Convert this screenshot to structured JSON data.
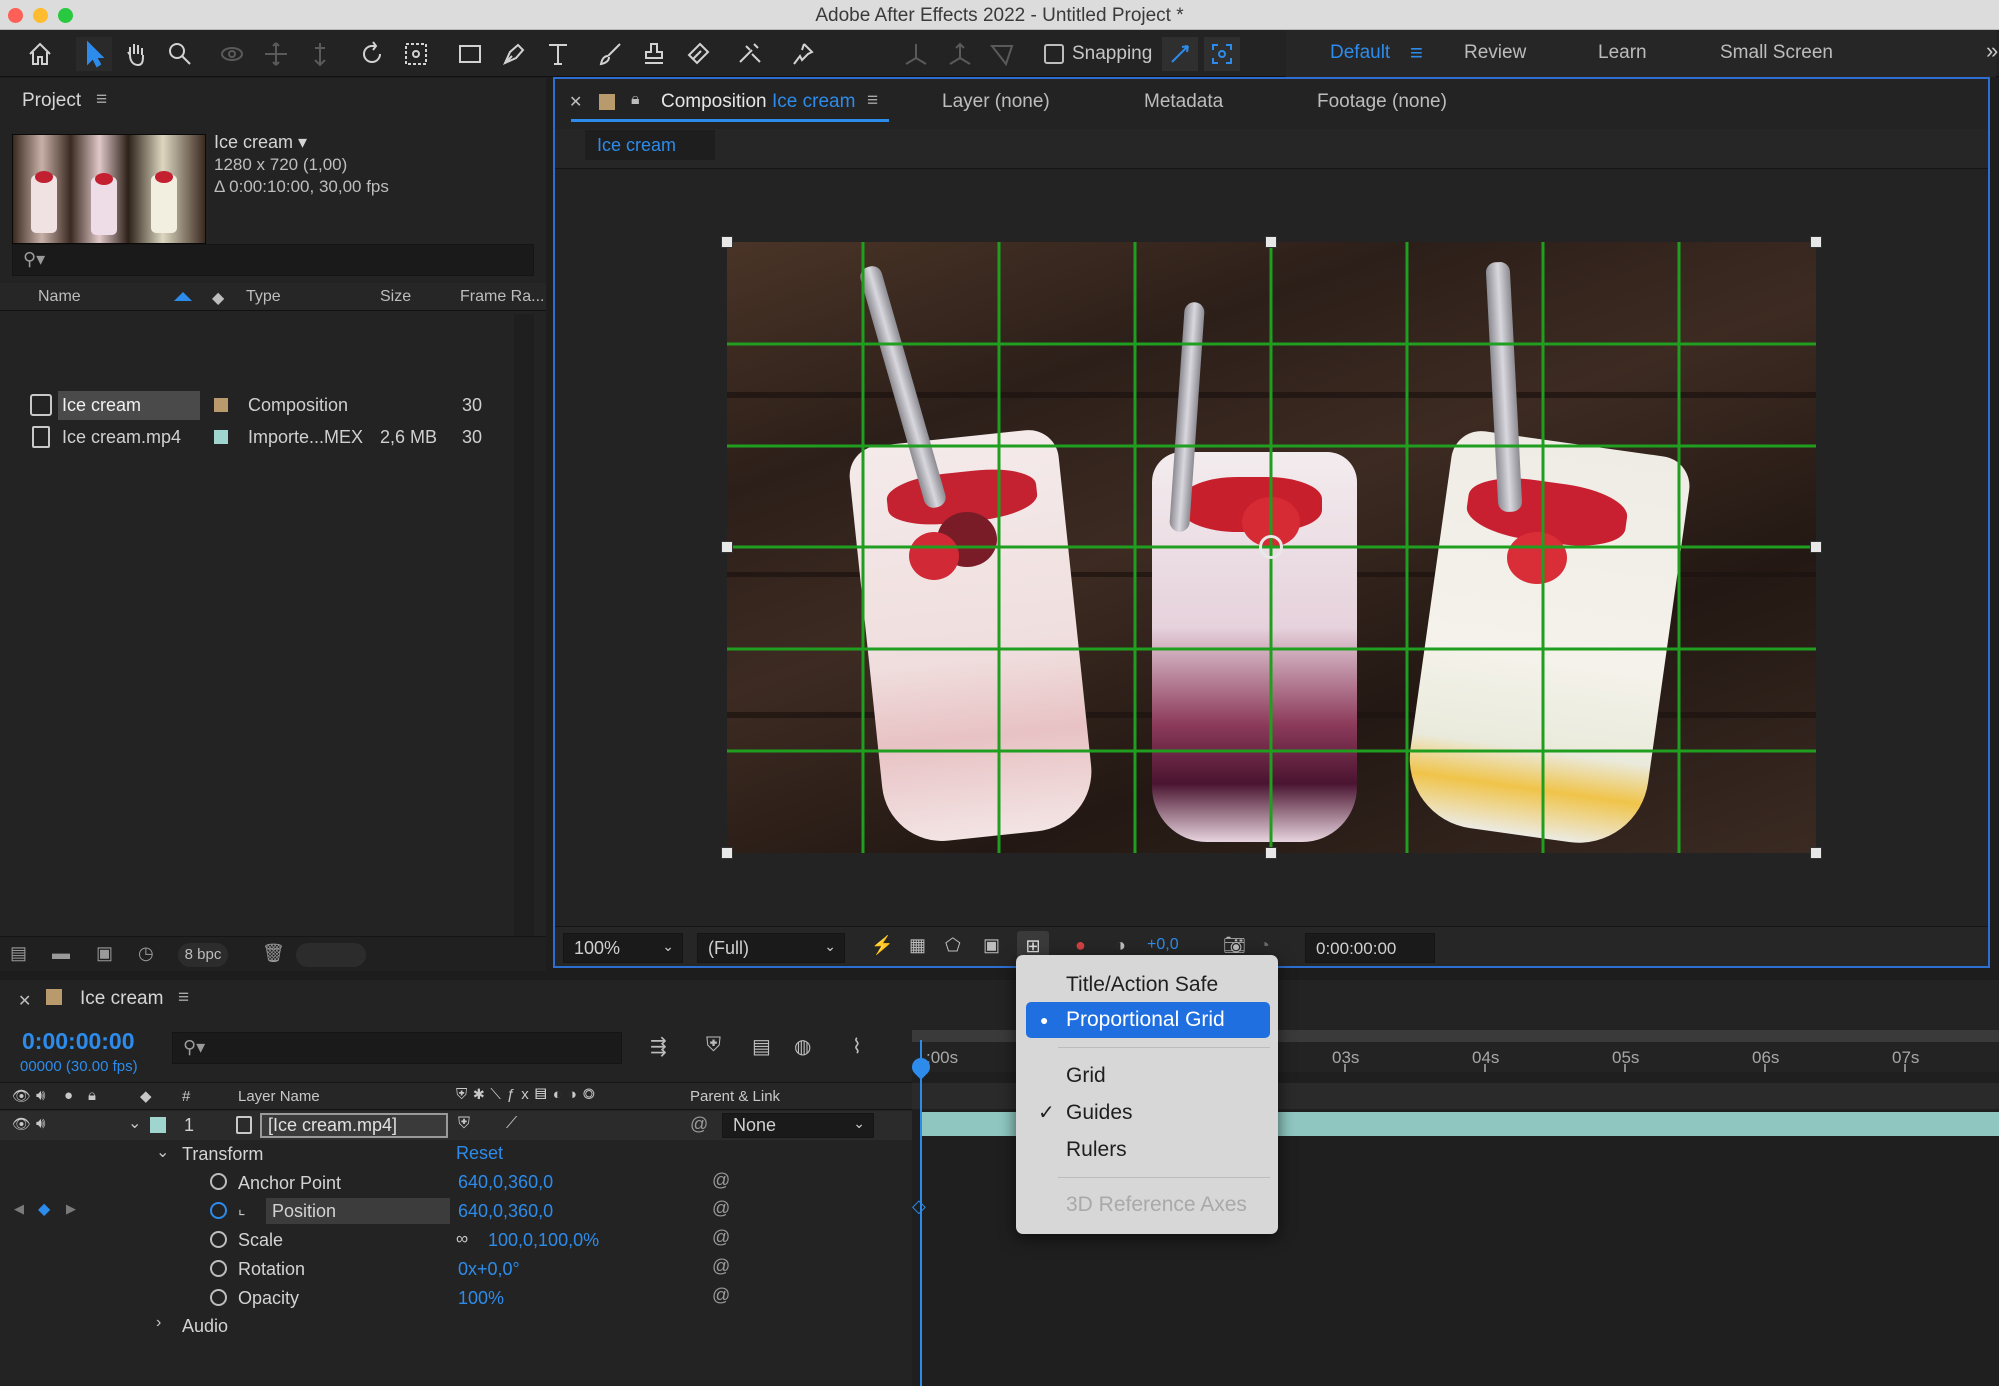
{
  "window": {
    "title": "Adobe After Effects 2022 - Untitled Project *"
  },
  "toolbar": {
    "snapping_label": "Snapping",
    "workspaces": [
      "Default",
      "Review",
      "Learn",
      "Small Screen"
    ]
  },
  "project_panel": {
    "title": "Project",
    "selected_item": {
      "name": "Ice cream ▾",
      "resolution": "1280 x 720 (1,00)",
      "duration": "Δ 0:00:10:00, 30,00 fps"
    },
    "search_placeholder": "",
    "columns": [
      "Name",
      "Type",
      "Size",
      "Frame Ra..."
    ],
    "rows": [
      {
        "name": "Ice cream",
        "type": "Composition",
        "size": "",
        "fps": "30",
        "label_color": "#b89a6c"
      },
      {
        "name": "Ice cream.mp4",
        "type": "Importe...MEX",
        "size": "2,6 MB",
        "fps": "30",
        "label_color": "#9fd4cf"
      }
    ],
    "bpc": "8 bpc"
  },
  "viewer": {
    "tabs": {
      "composition_prefix": "Composition",
      "composition_name": "Ice cream",
      "layer": "Layer (none)",
      "metadata": "Metadata",
      "footage": "Footage (none)"
    },
    "breadcrumb": "Ice cream",
    "zoom": "100%",
    "resolution": "(Full)",
    "exposure": "+0,0",
    "timecode": "0:00:00:00"
  },
  "timeline": {
    "tab": "Ice cream",
    "timecode": "0:00:00:00",
    "frame_info": "00000 (30.00 fps)",
    "col_layer_name": "Layer Name",
    "col_parent": "Parent & Link",
    "col_num": "#",
    "layer": {
      "index": "1",
      "name": "[Ice cream.mp4]",
      "parent": "None"
    },
    "transform": {
      "label": "Transform",
      "reset": "Reset"
    },
    "properties": [
      {
        "name": "Anchor Point",
        "value": "640,0,360,0"
      },
      {
        "name": "Position",
        "value": "640,0,360,0"
      },
      {
        "name": "Scale",
        "value": "100,0,100,0%"
      },
      {
        "name": "Rotation",
        "value": "0x+0,0°"
      },
      {
        "name": "Opacity",
        "value": "100%"
      }
    ],
    "audio": "Audio",
    "ruler_ticks": [
      ":00s",
      "03s",
      "04s",
      "05s",
      "06s",
      "07s"
    ]
  },
  "grid_menu": {
    "items": [
      {
        "label": "Title/Action Safe",
        "state": "normal"
      },
      {
        "label": "Proportional Grid",
        "state": "selected"
      },
      {
        "label": "Grid",
        "state": "normal"
      },
      {
        "label": "Guides",
        "state": "checked"
      },
      {
        "label": "Rulers",
        "state": "normal"
      },
      {
        "label": "3D Reference Axes",
        "state": "disabled"
      }
    ],
    "check_mark": "✓",
    "bullet": "●"
  },
  "colors": {
    "accent": "#2d8ceb",
    "grid": "#1f9e1f",
    "menu_highlight": "#1f6fe0"
  }
}
